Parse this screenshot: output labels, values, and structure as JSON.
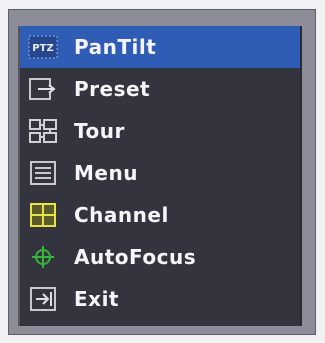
{
  "menu": {
    "selected": 0,
    "items": [
      {
        "label": "PanTilt",
        "icon": "pantilt-icon"
      },
      {
        "label": "Preset",
        "icon": "preset-icon"
      },
      {
        "label": "Tour",
        "icon": "tour-icon"
      },
      {
        "label": "Menu",
        "icon": "menu-icon"
      },
      {
        "label": "Channel",
        "icon": "channel-icon"
      },
      {
        "label": "AutoFocus",
        "icon": "autofocus-icon"
      },
      {
        "label": "Exit",
        "icon": "exit-icon"
      }
    ],
    "icon_text": {
      "pantilt": "PTZ"
    }
  },
  "colors": {
    "selected_background": "#2f5cb4",
    "menu_background": "#34343f",
    "frame_background": "#8d8d99",
    "channel_icon": "#e6e24a",
    "autofocus_icon": "#37b43a"
  }
}
